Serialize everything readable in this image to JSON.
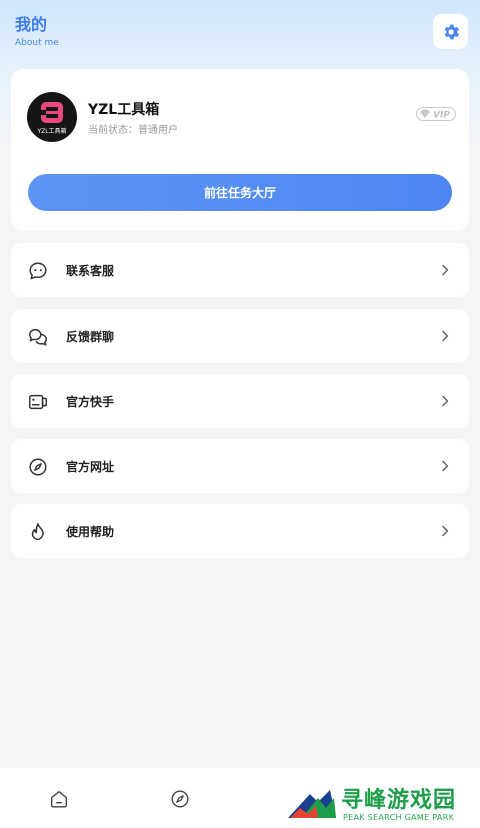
{
  "header": {
    "title": "我的",
    "subtitle": "About me"
  },
  "profile": {
    "name": "YZL工具箱",
    "status_label": "当前状态：",
    "status_value": "普通用户",
    "avatar_text": "YZL工具箱",
    "vip_badge": "VIP",
    "task_button": "前往任务大厅"
  },
  "menu": [
    {
      "label": "联系客服",
      "icon": "chat-bubble-icon"
    },
    {
      "label": "反馈群聊",
      "icon": "group-chat-icon"
    },
    {
      "label": "官方快手",
      "icon": "video-camera-icon"
    },
    {
      "label": "官方网址",
      "icon": "compass-icon"
    },
    {
      "label": "使用帮助",
      "icon": "flame-icon"
    }
  ],
  "bottom_nav": [
    {
      "icon": "home-icon"
    },
    {
      "icon": "compass-icon"
    }
  ],
  "watermark": {
    "title": "寻峰游戏园",
    "subtitle": "PEAK SEARCH GAME PARK"
  },
  "colors": {
    "accent": "#4d86f2",
    "header_text": "#3d7cf0",
    "background": "#f4f5f7"
  }
}
